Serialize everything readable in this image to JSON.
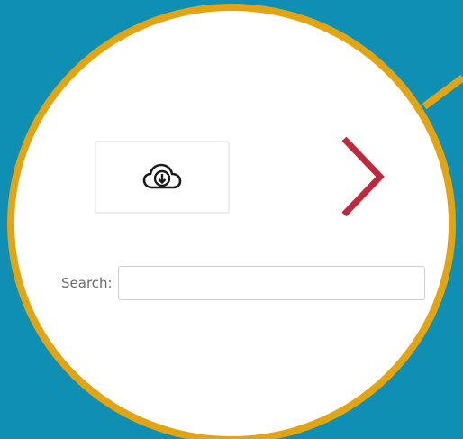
{
  "download": {
    "icon": "cloud-download-icon"
  },
  "navigation": {
    "next_icon": "chevron-right-icon"
  },
  "search": {
    "label": "Search:",
    "value": "",
    "placeholder": ""
  },
  "colors": {
    "background": "#0f8fb3",
    "circle_border": "#e3a414",
    "arrow": "#c0283b"
  }
}
